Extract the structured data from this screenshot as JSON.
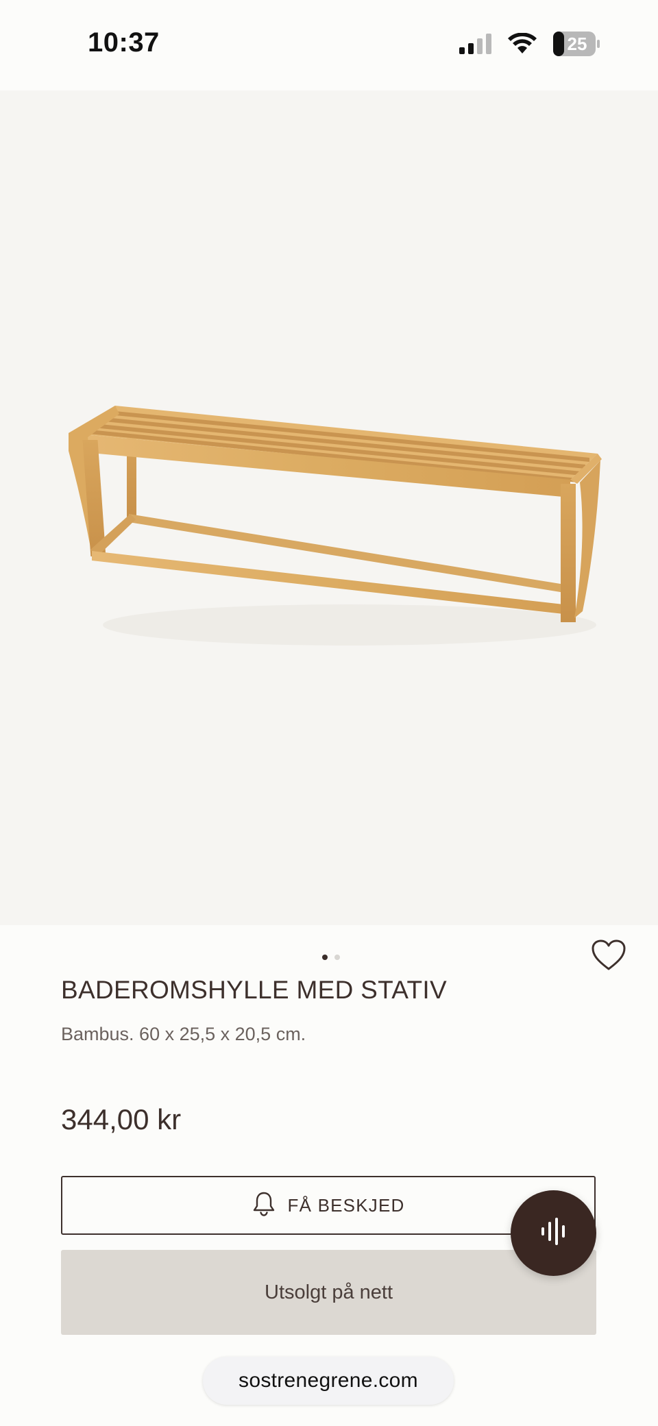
{
  "status_bar": {
    "time": "10:37",
    "battery_level": "25",
    "icons": [
      "signal-icon",
      "wifi-icon",
      "battery-icon"
    ]
  },
  "gallery": {
    "image": "bamboo-bathroom-shelf-bench",
    "slide_count": 2,
    "active_slide": 1
  },
  "product": {
    "title": "BADEROMSHYLLE MED STATIV",
    "description": "Bambus. 60 x 25,5 x 20,5 cm.",
    "price": "344,00 kr"
  },
  "actions": {
    "notify_label": "FÅ BESKJED",
    "notify_icon": "bell-icon",
    "soldout_label": "Utsolgt på nett",
    "favorite_icon": "heart-icon",
    "voice_icon": "voice-waveform-icon"
  },
  "browser": {
    "url": "sostrenegrene.com"
  },
  "colors": {
    "background": "#fcfcfa",
    "gallery_background": "#f6f5f2",
    "text_primary": "#3d302c",
    "soldout_background": "#dcd8d2",
    "fab_background": "#3a2722"
  }
}
